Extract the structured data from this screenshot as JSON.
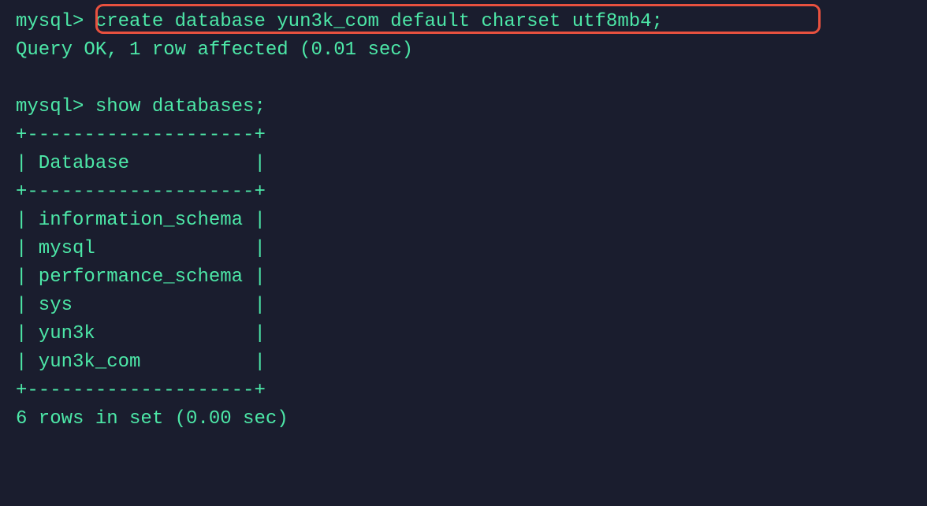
{
  "prompt": "mysql> ",
  "cmd1": "create database yun3k_com default charset utf8mb4;",
  "result1": "Query OK, 1 row affected (0.01 sec)",
  "cmd2": "show databases;",
  "table": {
    "border_top": "+--------------------+",
    "header": "| Database           |",
    "border_mid": "+--------------------+",
    "rows": [
      "| information_schema |",
      "| mysql              |",
      "| performance_schema |",
      "| sys                |",
      "| yun3k              |",
      "| yun3k_com          |"
    ],
    "border_bot": "+--------------------+"
  },
  "result2": "6 rows in set (0.00 sec)"
}
